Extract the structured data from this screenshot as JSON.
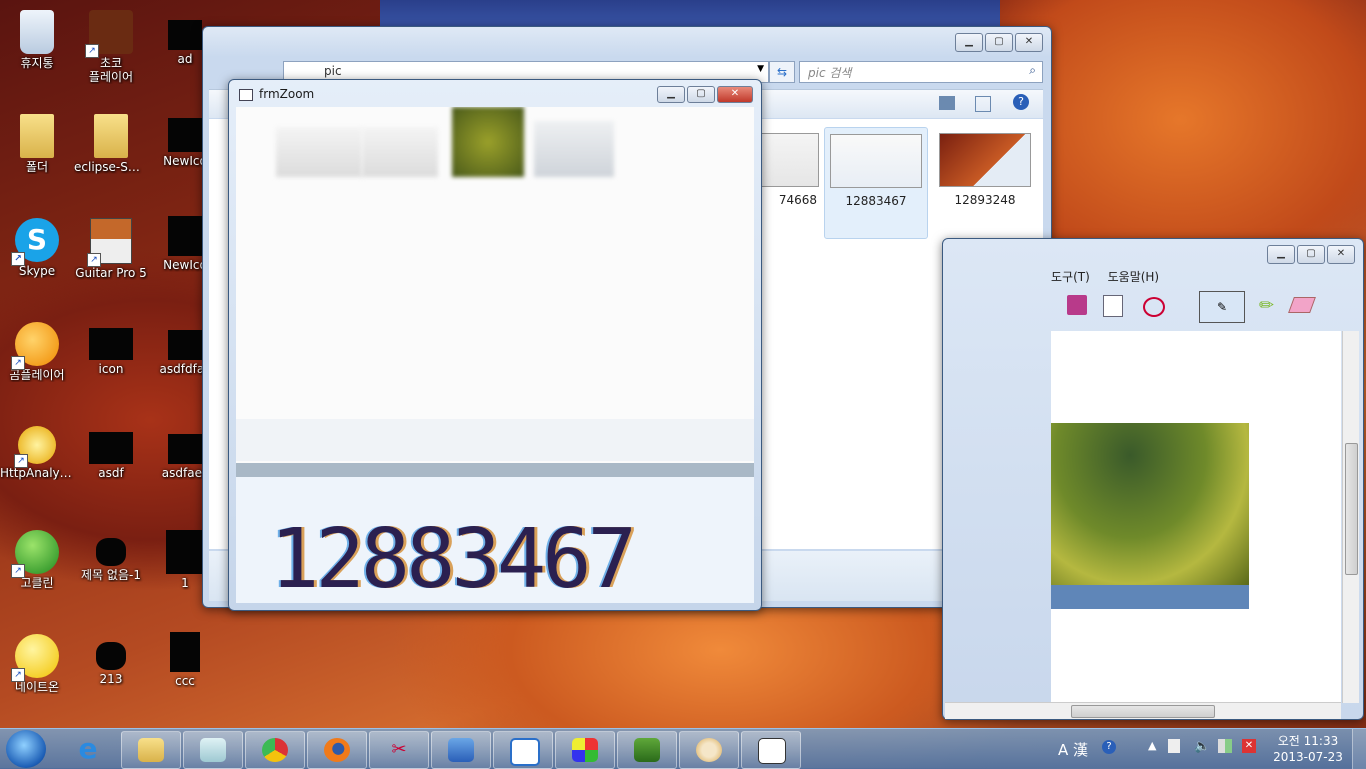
{
  "desktop": {
    "icons": [
      {
        "label": "휴지통"
      },
      {
        "label": "초코\n플레이어"
      },
      {
        "label": "ad"
      },
      {
        "label": "폴더"
      },
      {
        "label": "eclipse-SD..."
      },
      {
        "label": "NewIco"
      },
      {
        "label": "Skype"
      },
      {
        "label": "Guitar Pro 5"
      },
      {
        "label": "NewIco"
      },
      {
        "label": "곰플레이어"
      },
      {
        "label": "icon"
      },
      {
        "label": "asdfdfas"
      },
      {
        "label": "HttpAnalyz..."
      },
      {
        "label": "asdf"
      },
      {
        "label": "asdfaes"
      },
      {
        "label": "고클린"
      },
      {
        "label": "제목 없음-1"
      },
      {
        "label": "1"
      },
      {
        "label": "네이트온"
      },
      {
        "label": "213"
      },
      {
        "label": "ccc"
      }
    ]
  },
  "explorer": {
    "address": "pic",
    "search_placeholder": "pic 검색",
    "thumbs": [
      {
        "label": "74668"
      },
      {
        "label": "12883467"
      },
      {
        "label": "12893248"
      }
    ]
  },
  "zoom": {
    "title": "frmZoom",
    "number": "12883467"
  },
  "paint": {
    "menu": [
      "도구(T)",
      "도움말(H)"
    ]
  },
  "taskbar": {
    "time": "오전 11:33",
    "date": "2013-07-23",
    "ime": "A 漢"
  },
  "colors": {
    "taskbar": "#5f86b8",
    "close": "#c0392b"
  }
}
